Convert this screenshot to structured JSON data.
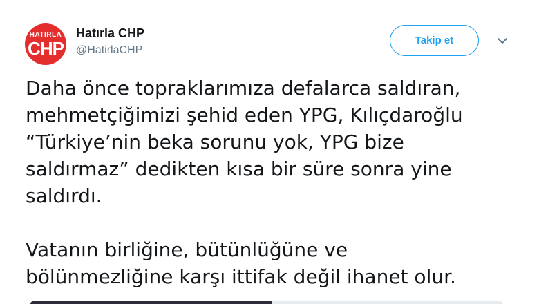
{
  "user": {
    "avatar_text_top": "HATIRLA",
    "avatar_text_bottom": "CHP",
    "display_name": "Hatırla CHP",
    "handle": "@HatirlaCHP"
  },
  "actions": {
    "follow_label": "Takip et",
    "menu_icon": "chevron-down-icon"
  },
  "tweet": {
    "paragraph1_lines": [
      "Daha önce topraklarımıza defalarca saldıran,",
      "mehmetçiğimizi şehid eden YPG, Kılıçdaroğlu",
      "“Türkiye’nin beka sorunu yok, YPG bize",
      "saldırmaz” dedikten kısa bir süre sonra yine",
      "saldırdı."
    ],
    "paragraph2_lines": [
      "Vatanın birliğine, bütünlüğüne ve",
      "bölünmezliğine karşı ittifak değil ihanet olur."
    ]
  },
  "colors": {
    "accent": "#1da1f2",
    "avatar_bg": "#e42d2d",
    "text": "#14171a",
    "secondary_text": "#657786"
  }
}
